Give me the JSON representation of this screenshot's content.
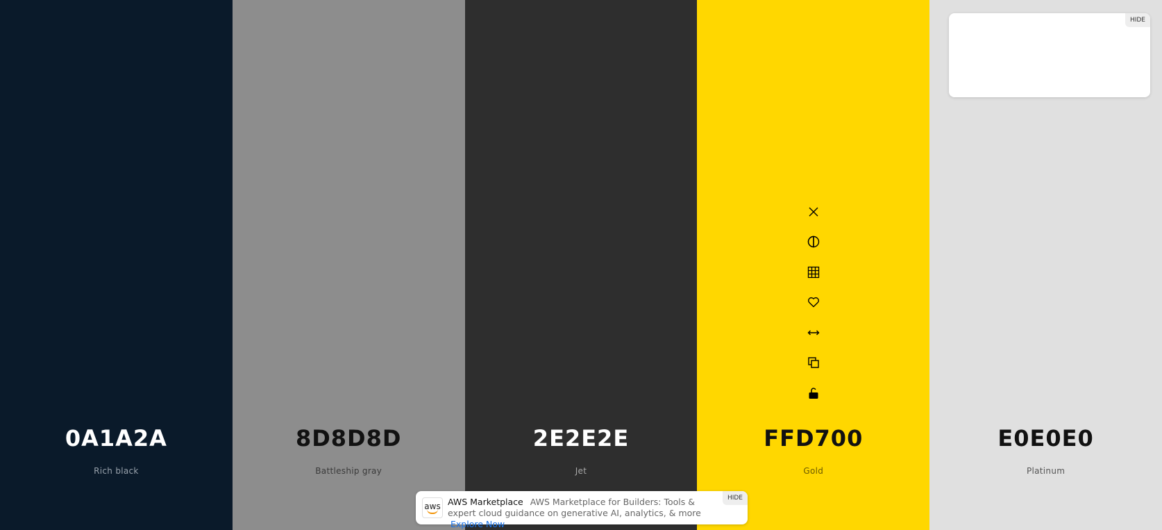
{
  "colors": [
    {
      "hex": "0A1A2A",
      "name": "Rich black",
      "bg": "#0A1A2A",
      "hex_text_color": "#ffffff",
      "name_text_color": "#9aa3ad"
    },
    {
      "hex": "8D8D8D",
      "name": "Battleship gray",
      "bg": "#8D8D8D",
      "hex_text_color": "#111111",
      "name_text_color": "#3a3a3a"
    },
    {
      "hex": "2E2E2E",
      "name": "Jet",
      "bg": "#2E2E2E",
      "hex_text_color": "#ffffff",
      "name_text_color": "#a8a8a8"
    },
    {
      "hex": "FFD700",
      "name": "Gold",
      "bg": "#FFD700",
      "hex_text_color": "#111111",
      "name_text_color": "#6b5a00"
    },
    {
      "hex": "E0E0E0",
      "name": "Platinum",
      "bg": "#E0E0E0",
      "hex_text_color": "#111111",
      "name_text_color": "#555555"
    }
  ],
  "tools": [
    {
      "icon": "close-icon",
      "action": "remove"
    },
    {
      "icon": "contrast-icon",
      "action": "shades"
    },
    {
      "icon": "grid-icon",
      "action": "view-shades"
    },
    {
      "icon": "heart-icon",
      "action": "save"
    },
    {
      "icon": "drag-horizontal-icon",
      "action": "drag"
    },
    {
      "icon": "copy-icon",
      "action": "copy"
    },
    {
      "icon": "unlock-icon",
      "action": "lock"
    }
  ],
  "ad_top": {
    "hide_label": "HIDE"
  },
  "ad_bottom": {
    "logo_text": "aws",
    "title": "AWS Marketplace",
    "body": "AWS Marketplace for Builders: Tools & expert cloud guidance on generative AI, analytics, & more",
    "cta": "Explore Now",
    "hide_label": "HIDE"
  }
}
